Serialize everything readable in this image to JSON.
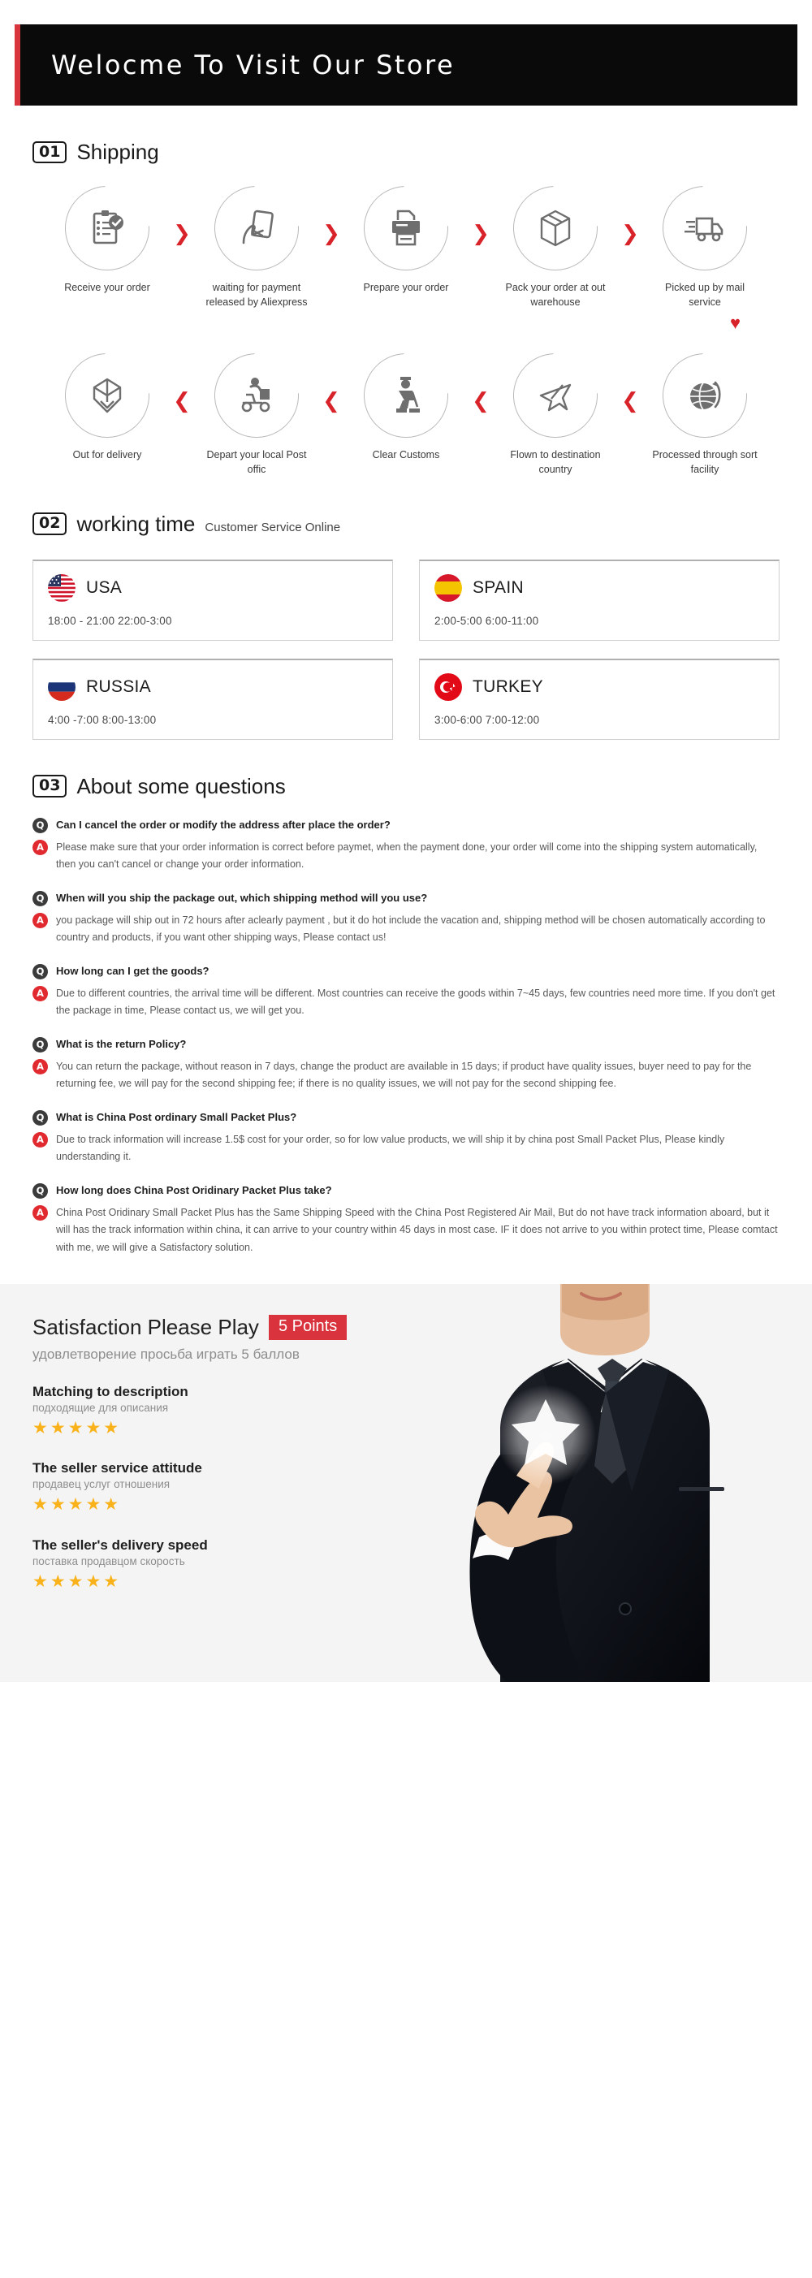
{
  "banner": {
    "title": "Welocme To Visit Our Store"
  },
  "shipping": {
    "number": "01",
    "title": "Shipping",
    "row1": [
      {
        "icon": "clipboard-check-icon",
        "label": "Receive your order"
      },
      {
        "icon": "hand-card-icon",
        "label": "waiting for payment released by Aliexpress"
      },
      {
        "icon": "printer-icon",
        "label": "Prepare your order"
      },
      {
        "icon": "box-icon",
        "label": "Pack your order at out warehouse"
      },
      {
        "icon": "truck-icon",
        "label": "Picked up by mail service"
      }
    ],
    "row2": [
      {
        "icon": "open-box-icon",
        "label": "Out  for delivery"
      },
      {
        "icon": "scooter-courier-icon",
        "label": "Depart your local Post offic"
      },
      {
        "icon": "customs-officer-icon",
        "label": "Clear Customs"
      },
      {
        "icon": "airplane-icon",
        "label": "Flown to destination country"
      },
      {
        "icon": "globe-arrow-icon",
        "label": "Processed through sort facility"
      }
    ],
    "chevron_right": "❯",
    "chevron_left": "❮",
    "down_arrow": "♥"
  },
  "working_time": {
    "number": "02",
    "title": "working time",
    "subtitle": "Customer Service Online",
    "cards": [
      {
        "country": "USA",
        "flag": "flag-usa-icon",
        "hours": "18:00 - 21:00   22:00-3:00"
      },
      {
        "country": "SPAIN",
        "flag": "flag-spain-icon",
        "hours": "2:00-5:00    6:00-11:00"
      },
      {
        "country": "RUSSIA",
        "flag": "flag-russia-icon",
        "hours": "4:00 -7:00   8:00-13:00"
      },
      {
        "country": "TURKEY",
        "flag": "flag-turkey-icon",
        "hours": "3:00-6:00    7:00-12:00"
      }
    ]
  },
  "faq": {
    "number": "03",
    "title": "About some questions",
    "q_badge": "Q",
    "a_badge": "A",
    "items": [
      {
        "q": "Can I cancel the order or modify the address after place the order?",
        "a": "Please make sure that your order information is correct before paymet, when the payment done, your order will come into the shipping system automatically, then you can't cancel or change your order information."
      },
      {
        "q": "When will you ship the package out, which shipping method will you use?",
        "a": "you package will ship out in 72 hours after aclearly payment , but it do hot include the vacation and, shipping method will be chosen automatically according to country and products, if you want other shipping ways, Please contact us!"
      },
      {
        "q": "How long can I get the goods?",
        "a": "Due to different countries, the arrival time will be different. Most countries can receive the goods within 7~45 days, few countries need more time. If you don't get the package in time, Please contact us, we will get you."
      },
      {
        "q": "What is the return Policy?",
        "a": "You can return the package, without reason in 7 days, change the product are available in 15 days; if product have quality issues, buyer need to pay for the returning fee, we will pay for the second shipping fee; if there is no quality issues, we will not pay for the second shipping fee."
      },
      {
        "q": "What is China Post ordinary Small Packet Plus?",
        "a": "Due to track information will increase 1.5$ cost for your order, so for low value products, we will ship it by china post Small Packet Plus, Please kindly understanding it."
      },
      {
        "q": "How long does China Post Oridinary Packet Plus take?",
        "a": "China Post Oridinary Small Packet Plus has the Same Shipping Speed with the China Post Registered Air Mail, But do not have track information aboard, but it will has the track information within china, it can arrive to your country within 45 days in most case. IF it does not arrive to you within protect time, Please comtact with me, we will give a Satisfactory solution."
      }
    ]
  },
  "feedback": {
    "title": "Satisfaction Please Play",
    "points_badge": "5 Points",
    "subtitle": "удовлетворение просьба играть 5 баллов",
    "stars": "★★★★★",
    "ratings": [
      {
        "title": "Matching to description",
        "sub": "подходящие для описания"
      },
      {
        "title": "The seller service attitude",
        "sub": "продавец услуг отношения"
      },
      {
        "title": "The seller's delivery speed",
        "sub": "поставка продавцом скорость"
      }
    ],
    "photo": "businessman-pointing-star-photo"
  },
  "colors": {
    "accent_red": "#d8353f",
    "badge_red": "#e02a2f",
    "star_gold": "#f9b21a",
    "icon_gray": "#6e6e6e"
  }
}
